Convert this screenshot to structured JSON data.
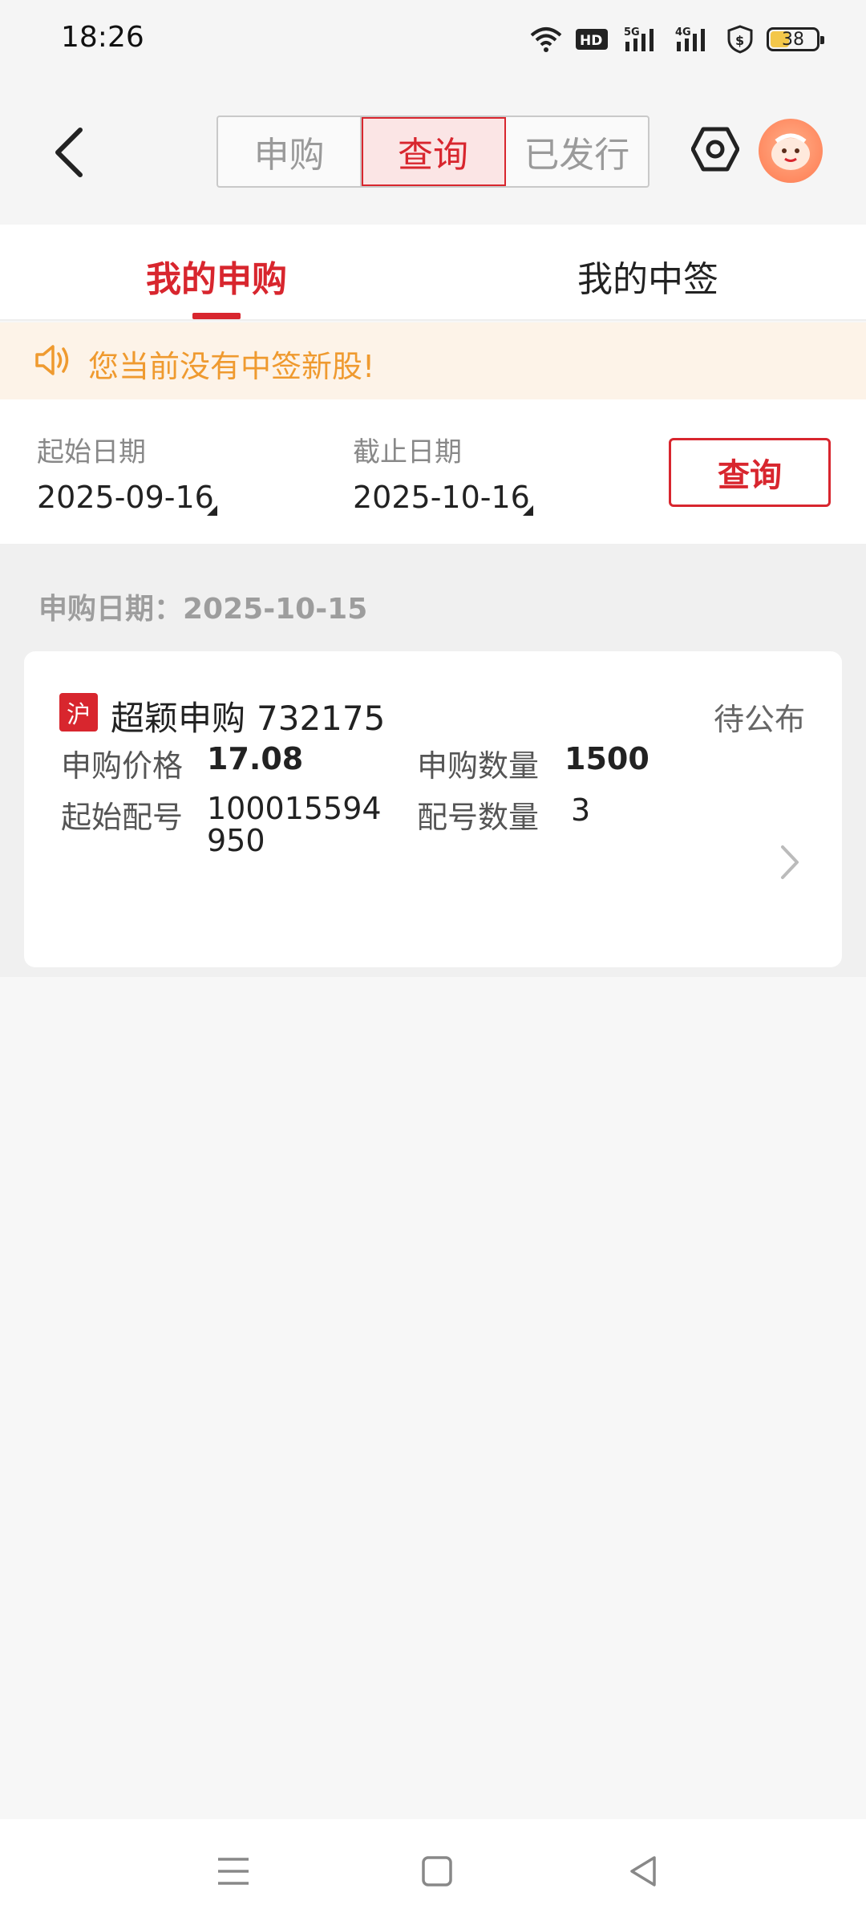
{
  "status_bar": {
    "time": "18:26",
    "hd_label": "HD",
    "signal_1_label": "5G",
    "signal_2_label": "4G",
    "battery_level": "38",
    "icons": [
      "wifi-icon",
      "hd-icon",
      "signal-5g-icon",
      "signal-4g-icon",
      "shield-dollar-icon",
      "battery-icon"
    ]
  },
  "nav": {
    "segments": [
      {
        "label": "申购",
        "active": false
      },
      {
        "label": "查询",
        "active": true
      },
      {
        "label": "已发行",
        "active": false
      }
    ],
    "icons": [
      "back-icon",
      "settings-hexagon-icon",
      "avatar-icon"
    ]
  },
  "subtabs": [
    {
      "label": "我的申购",
      "active": true
    },
    {
      "label": "我的中签",
      "active": false
    }
  ],
  "notice": {
    "text": "您当前没有中签新股!",
    "icon": "speaker-icon"
  },
  "filter": {
    "start_label": "起始日期",
    "start_value": "2025-09-16",
    "end_label": "截止日期",
    "end_value": "2025-10-16",
    "query_button": "查询"
  },
  "records": {
    "date_header": "申购日期：2025-10-15",
    "items": [
      {
        "market": "沪",
        "name": "超颖申购",
        "code": "732175",
        "status": "待公布",
        "price_label": "申购价格",
        "price": "17.08",
        "qty_label": "申购数量",
        "qty": "1500",
        "start_no_label": "起始配号",
        "start_no": "100015594950",
        "count_label": "配号数量",
        "count": "3"
      }
    ]
  },
  "colors": {
    "accent": "#d8262e",
    "notice_text": "#ef9a2f",
    "notice_bg": "#fdf3e8"
  }
}
